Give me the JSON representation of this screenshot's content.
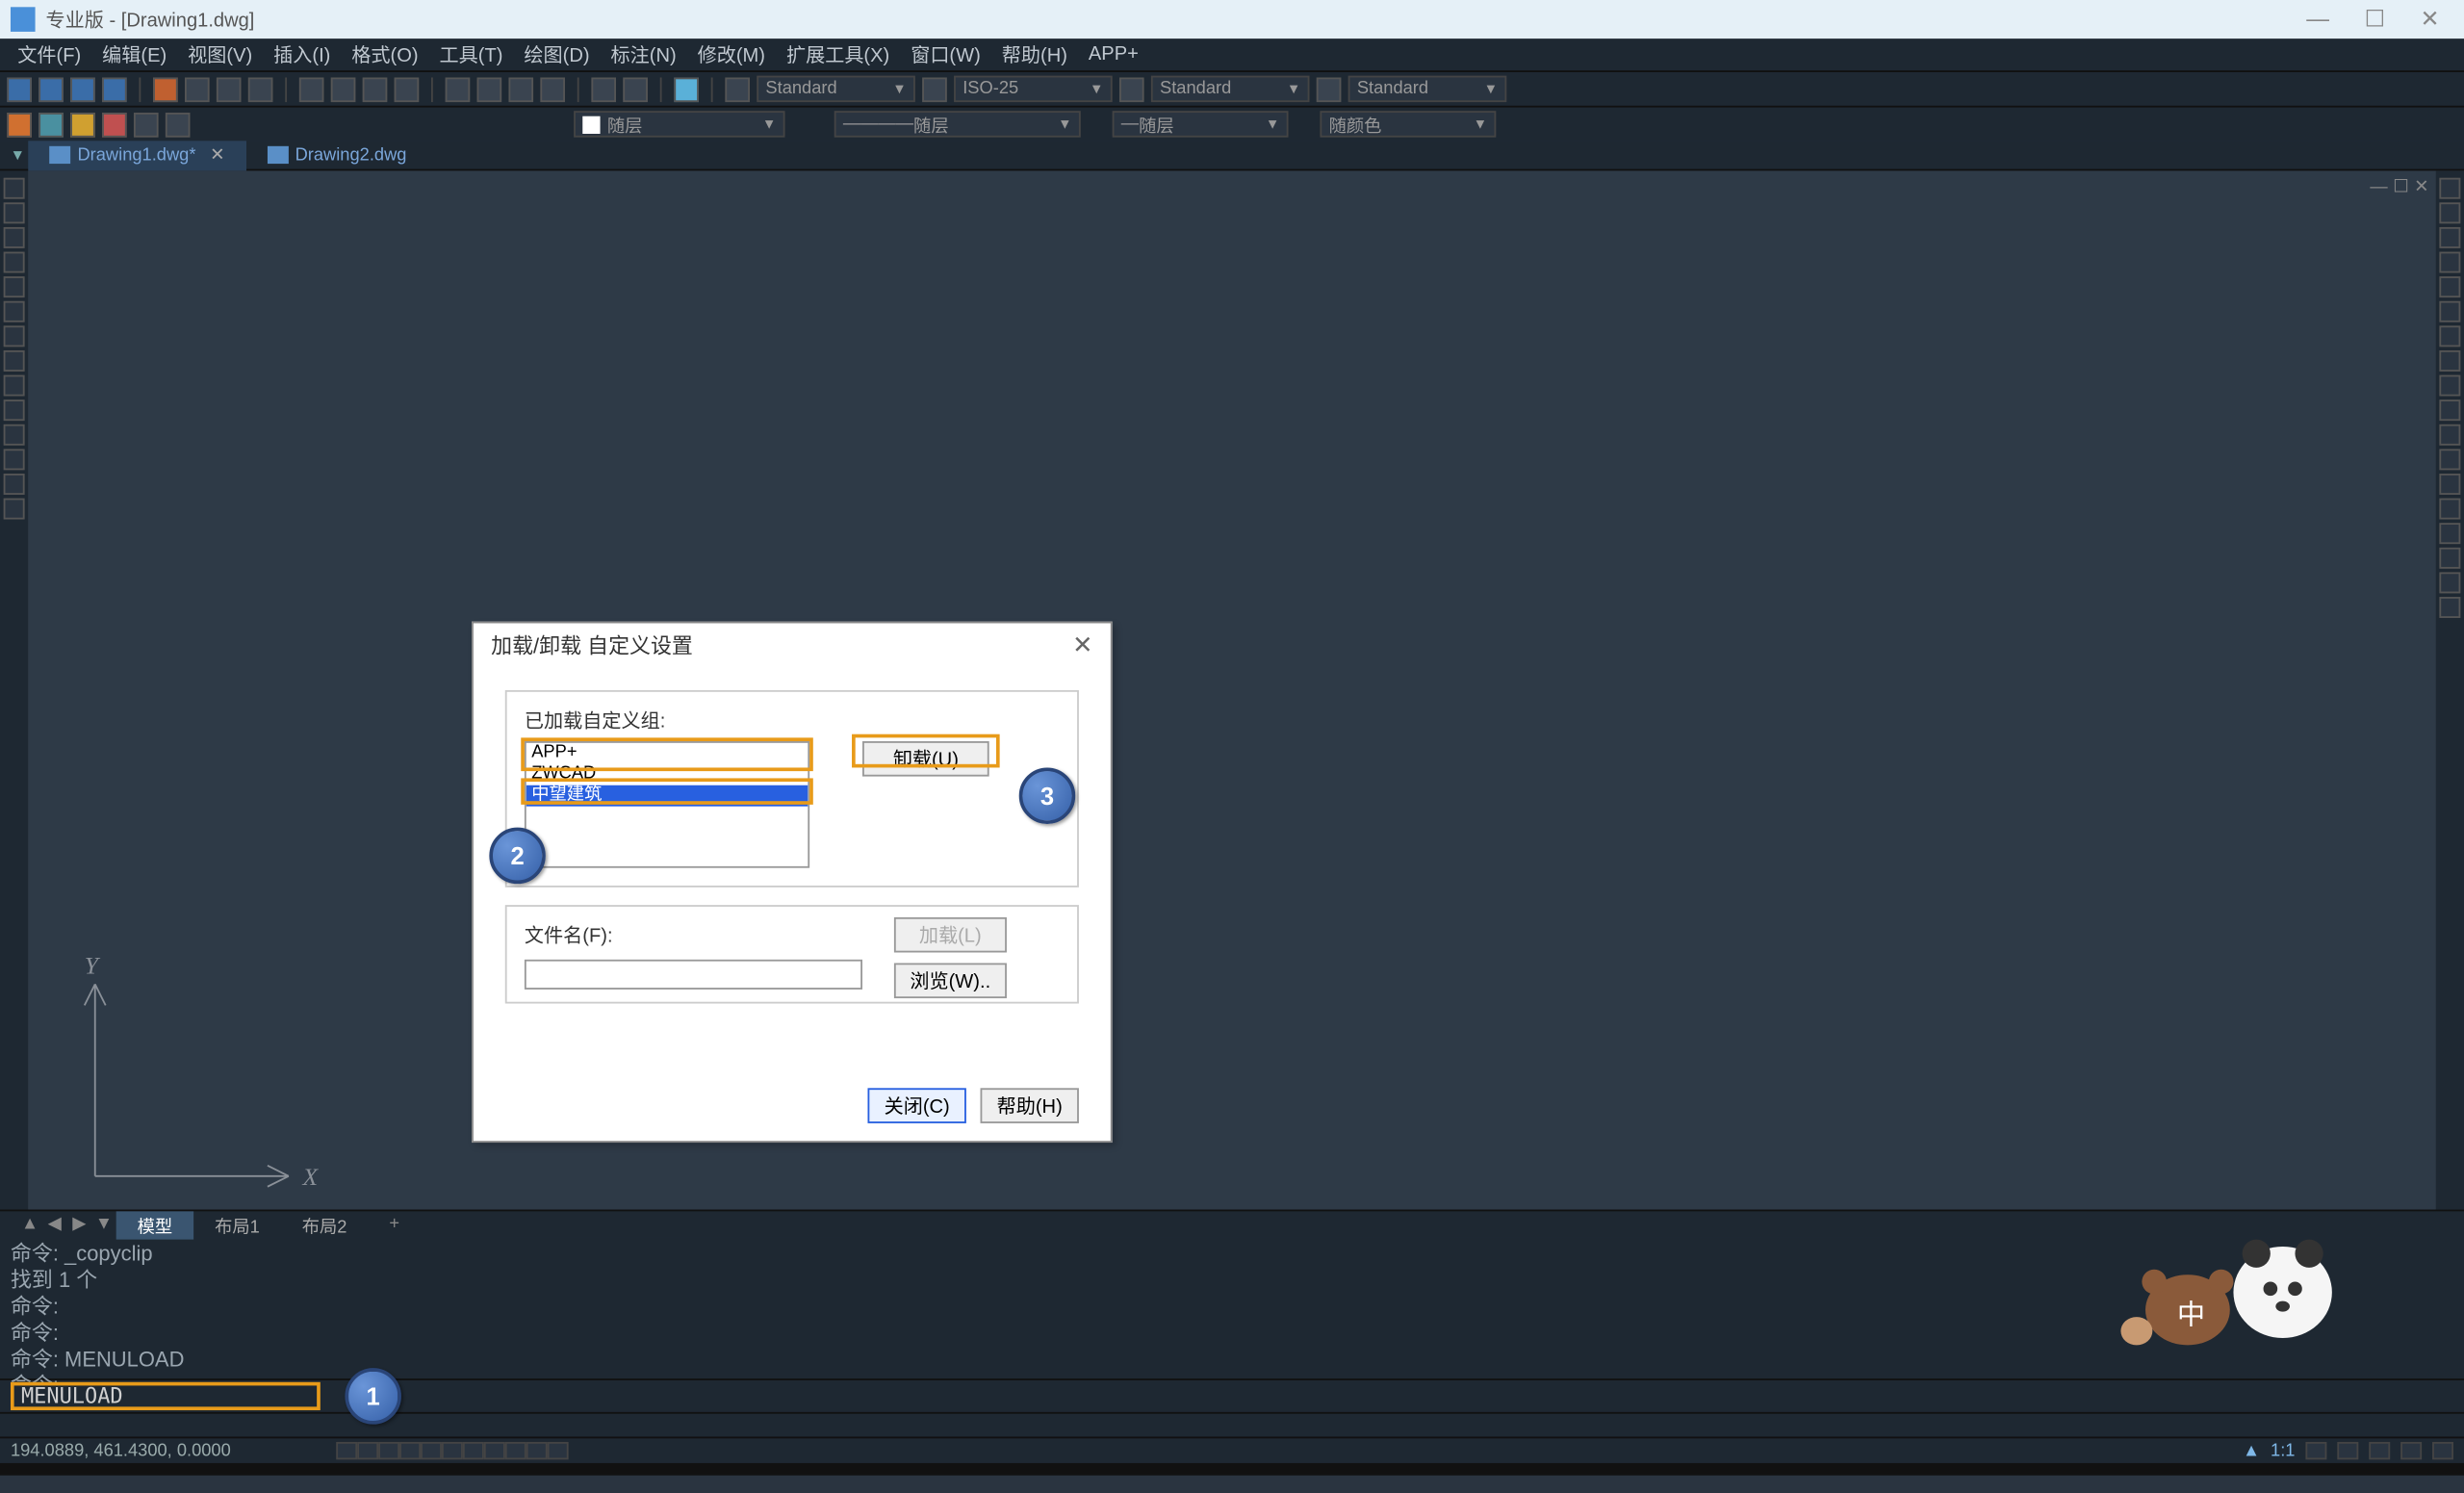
{
  "window": {
    "title": "专业版 - [Drawing1.dwg]",
    "controls": {
      "min": "—",
      "max": "☐",
      "close": "✕"
    }
  },
  "menu": [
    "文件(F)",
    "编辑(E)",
    "视图(V)",
    "插入(I)",
    "格式(O)",
    "工具(T)",
    "绘图(D)",
    "标注(N)",
    "修改(M)",
    "扩展工具(X)",
    "窗口(W)",
    "帮助(H)",
    "APP+"
  ],
  "toolbar1": {
    "text_style": "Standard",
    "dim_style": "ISO-25",
    "tbl_style": "Standard",
    "ml_style": "Standard"
  },
  "toolbar2": {
    "layer_a": "随层",
    "layer_b": "随层",
    "layer_c": "随层",
    "color": "随颜色"
  },
  "tabs": [
    {
      "name": "Drawing1.dwg*",
      "active": true
    },
    {
      "name": "Drawing2.dwg",
      "active": false
    }
  ],
  "vp_controls": [
    "—",
    "☐",
    "✕"
  ],
  "dialog": {
    "title": "加载/卸载 自定义设置",
    "group1_label": "已加载自定义组:",
    "items": [
      "APP+",
      "ZWCAD",
      "中望建筑"
    ],
    "selected": "中望建筑",
    "btn_unload": "卸载(U)",
    "filename_label": "文件名(F):",
    "filename_value": "",
    "btn_load": "加载(L)",
    "btn_browse": "浏览(W)..",
    "btn_close": "关闭(C)",
    "btn_help": "帮助(H)"
  },
  "badges": {
    "b1": "1",
    "b2": "2",
    "b3": "3"
  },
  "ucs": {
    "x": "X",
    "y": "Y"
  },
  "layout_tabs": {
    "model": "模型",
    "l1": "布局1",
    "l2": "布局2",
    "add": "+"
  },
  "command_history": [
    "命令: _copyclip",
    "找到 1 个",
    "命令:",
    "命令:",
    "命令: MENULOAD",
    "命令:"
  ],
  "command_input": "MENULOAD",
  "status": {
    "coords": "194.0889, 461.4300, 0.0000",
    "ratio": "1:1"
  },
  "ime": {
    "text": "中"
  }
}
